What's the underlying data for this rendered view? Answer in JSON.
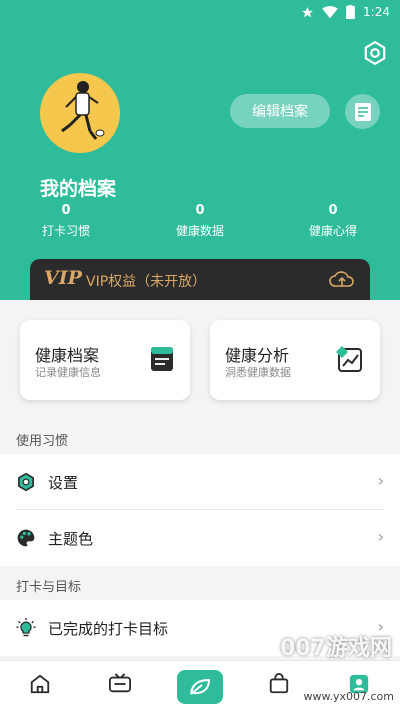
{
  "status": {
    "time": "1:24"
  },
  "colors": {
    "accent": "#2fbc9b",
    "vip_gold": "#d9a867"
  },
  "profile": {
    "title": "我的档案",
    "edit_button": "编辑档案"
  },
  "stats": [
    {
      "value": "0",
      "label": "打卡习惯"
    },
    {
      "value": "0",
      "label": "健康数据"
    },
    {
      "value": "0",
      "label": "健康心得"
    }
  ],
  "vip": {
    "logo": "VIP",
    "label": "VIP权益（未开放）"
  },
  "cards": [
    {
      "title": "健康档案",
      "subtitle": "记录健康信息",
      "icon": "archive-box-icon"
    },
    {
      "title": "健康分析",
      "subtitle": "洞悉健康数据",
      "icon": "chart-analysis-icon"
    }
  ],
  "sections": {
    "habits": "使用习惯",
    "goals": "打卡与目标"
  },
  "rows": [
    {
      "label": "设置",
      "icon": "hexagon-settings-icon"
    },
    {
      "label": "主题色",
      "icon": "palette-icon"
    },
    {
      "label": "已完成的打卡目标",
      "icon": "lightbulb-icon"
    }
  ],
  "nav": [
    {
      "icon": "home-icon"
    },
    {
      "icon": "tv-icon"
    },
    {
      "icon": "leaf-icon"
    },
    {
      "icon": "bag-icon"
    },
    {
      "icon": "profile-icon"
    }
  ],
  "watermark": {
    "brand": "007游戏网",
    "url": "www.yx007.com"
  }
}
